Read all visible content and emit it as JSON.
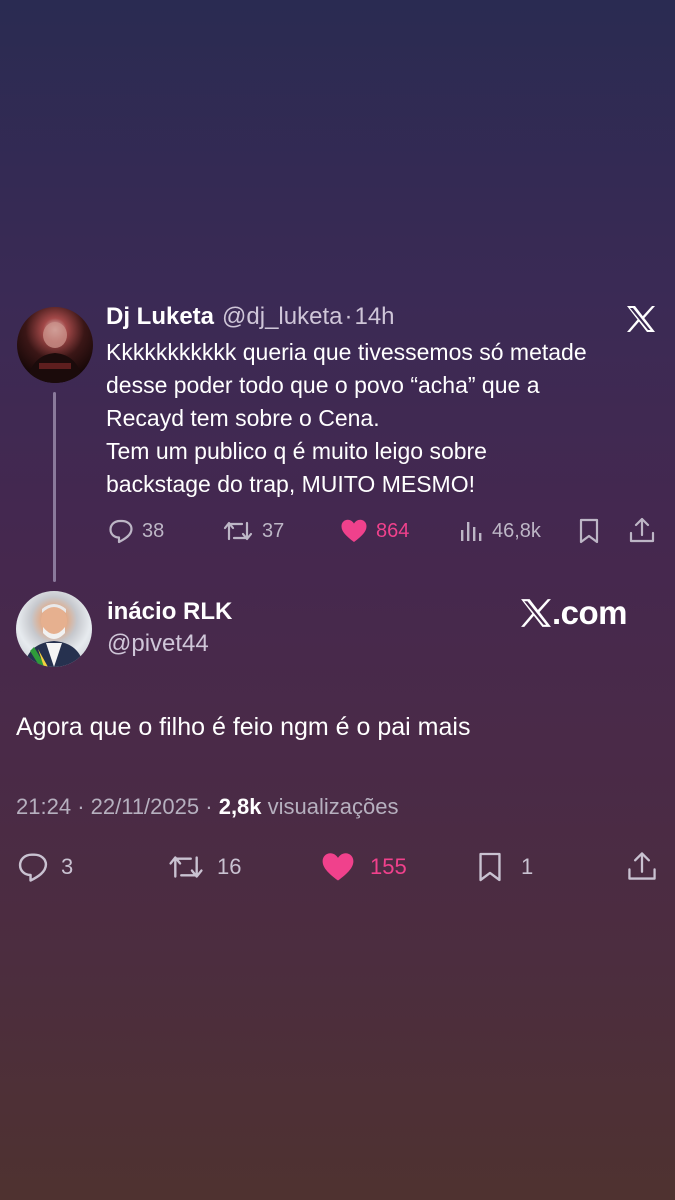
{
  "tweet1": {
    "author_name": "Dj Luketa",
    "handle": "@dj_luketa",
    "separator": "·",
    "time": "14h",
    "text": "Kkkkkkkkkkk queria que tivessemos só metade\ndesse poder todo que o povo “acha” que a\nRecayd tem sobre o Cena.\nTem um publico q é muito leigo sobre\nbackstage do trap, MUITO MESMO!",
    "replies": "38",
    "reposts": "37",
    "likes": "864",
    "views": "46,8k"
  },
  "tweet2": {
    "author_name": "inácio RLK",
    "handle": "@pivet44",
    "text": "Agora que o filho é feio ngm é o pai mais",
    "time": "21:24",
    "date": "22/11/2025",
    "views_count": "2,8k",
    "views_label": "visualizações",
    "sep": "·",
    "replies": "3",
    "reposts": "16",
    "likes": "155",
    "bookmarks": "1"
  },
  "branding": {
    "xcom_suffix": ".com"
  },
  "icons": {
    "x_logo": "x-logo-icon",
    "reply": "reply-icon",
    "repost": "repost-icon",
    "like": "heart-icon",
    "views": "views-bar-icon",
    "bookmark": "bookmark-icon",
    "share": "share-icon"
  },
  "colors": {
    "like_pink": "#f0418c",
    "muted": "#bdb6c6"
  }
}
